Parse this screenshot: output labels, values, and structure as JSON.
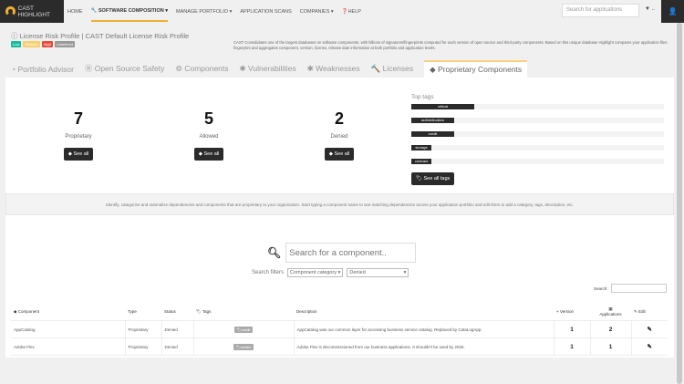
{
  "brand": "CAST HIGHLIGHT",
  "nav": [
    "HOME",
    "SOFTWARE COMPOSITION",
    "MANAGE PORTFOLIO",
    "APPLICATION SCANS",
    "COMPANIES",
    "HELP"
  ],
  "app_search_placeholder": "Search for applications",
  "license_profile": "License Risk Profile | CAST Default License Risk Profile",
  "badges": [
    {
      "label": "Low",
      "color": "#1abc9c"
    },
    {
      "label": "Medium",
      "color": "#f8d070"
    },
    {
      "label": "High",
      "color": "#e74c3c"
    },
    {
      "label": "Undefined",
      "color": "#999999"
    }
  ],
  "intro": "CAST Consolidates one of the largest databases on software components, with billions of signatures/fingerprints computed for each version of open source and third-party components. Based on this unique database Highlight compares your application files fingerprint and aggregates component, version, license, release date information at both portfolio and application levels.",
  "tabs": [
    "Portfolio Advisor",
    "Open Source Safety",
    "Components",
    "Vulnerabilities",
    "Weaknesses",
    "Licenses",
    "Proprietary Components"
  ],
  "stats": [
    {
      "value": "7",
      "label": "Proprietary"
    },
    {
      "value": "5",
      "label": "Allowed"
    },
    {
      "value": "2",
      "label": "Denied"
    }
  ],
  "see_all": "See all",
  "top_tags": {
    "title": "Top tags",
    "button": "See all tags",
    "tags": [
      {
        "name": "critical",
        "percent": 25
      },
      {
        "name": "authentication",
        "percent": 17
      },
      {
        "name": "credit",
        "percent": 17
      },
      {
        "name": "storage",
        "percent": 8
      },
      {
        "name": "contract",
        "percent": 8
      }
    ]
  },
  "info": "Identify, categorize and rationalize dependencies and components that are proprietary to your organization. Start typing a component name to see matching dependencies across your application portfolio and edit them to add a category, tags, description, etc.",
  "component_search_placeholder": "Search for a component..",
  "filters": {
    "label": "Search filters",
    "category": "Component category",
    "status": "Denied"
  },
  "table_search_label": "Search:",
  "columns": [
    "Component",
    "Type",
    "Status",
    "Tags",
    "Description",
    "Version",
    "Applications",
    "Edit"
  ],
  "rows": [
    {
      "component": "AppCatalog",
      "type": "Proprietary",
      "status": "Denied",
      "tag": "credit",
      "description": "AppCatalog was our common layer for accessing business service catalog. Replaced by CataLogApp.",
      "version": "1",
      "applications": "2"
    },
    {
      "component": "Adobe Flex",
      "type": "Proprietary",
      "status": "Denied",
      "tag": "mobile",
      "description": "Adobe Flex is decommissioned from our business applications. It shouldn't be used by 2025.",
      "version": "1",
      "applications": "1"
    }
  ]
}
